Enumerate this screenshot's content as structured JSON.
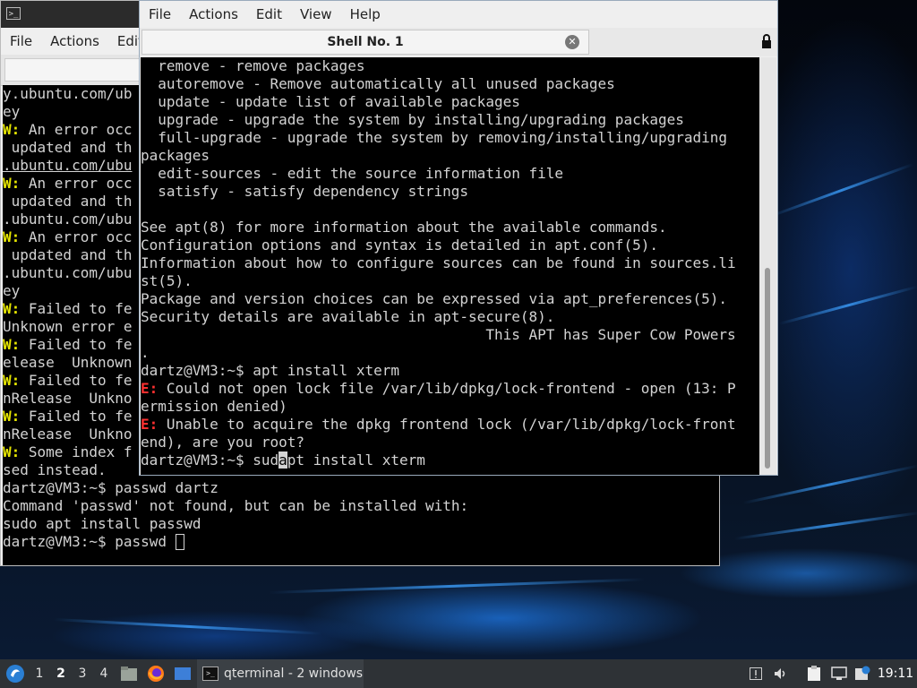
{
  "colors": {
    "terminal_bg": "#000000",
    "terminal_fg": "#d3d3d3",
    "warning": "#e6e600",
    "error": "#ff3030",
    "taskbar_bg": "#2e3236",
    "menubar_bg": "#efefef"
  },
  "back_window": {
    "menu": [
      "File",
      "Actions",
      "Edit"
    ],
    "terminal_lines": [
      {
        "prefix": "",
        "text": "y.ubuntu.com/ub",
        "style": ""
      },
      {
        "prefix": "",
        "text": "ey",
        "style": ""
      },
      {
        "prefix": "W:",
        "text": " An error occ",
        "style": ""
      },
      {
        "prefix": "",
        "text": " updated and th",
        "style": ""
      },
      {
        "prefix": "",
        "text": ".ubuntu.com/ubu",
        "style": "ul"
      },
      {
        "prefix": "W:",
        "text": " An error occ",
        "style": ""
      },
      {
        "prefix": "",
        "text": " updated and th",
        "style": ""
      },
      {
        "prefix": "",
        "text": ".ubuntu.com/ubu",
        "style": ""
      },
      {
        "prefix": "W:",
        "text": " An error occ",
        "style": ""
      },
      {
        "prefix": "",
        "text": " updated and th",
        "style": ""
      },
      {
        "prefix": "",
        "text": ".ubuntu.com/ubu",
        "style": ""
      },
      {
        "prefix": "",
        "text": "ey",
        "style": ""
      },
      {
        "prefix": "W:",
        "text": " Failed to fe",
        "style": ""
      },
      {
        "prefix": "",
        "text": "Unknown error e",
        "style": ""
      },
      {
        "prefix": "W:",
        "text": " Failed to fe",
        "style": ""
      },
      {
        "prefix": "",
        "text": "elease  Unknown",
        "style": ""
      },
      {
        "prefix": "W:",
        "text": " Failed to fe",
        "style": ""
      },
      {
        "prefix": "",
        "text": "nRelease  Unkno",
        "style": ""
      },
      {
        "prefix": "W:",
        "text": " Failed to fe",
        "style": ""
      },
      {
        "prefix": "",
        "text": "nRelease  Unkno",
        "style": ""
      },
      {
        "prefix": "W:",
        "text": " Some index f",
        "style": ""
      },
      {
        "prefix": "",
        "text": "sed instead.",
        "style": ""
      },
      {
        "prefix": "",
        "text": "dartz@VM3:~$ passwd dartz",
        "style": ""
      },
      {
        "prefix": "",
        "text": "Command 'passwd' not found, but can be installed with:",
        "style": ""
      },
      {
        "prefix": "",
        "text": "sudo apt install passwd",
        "style": ""
      },
      {
        "prefix": "",
        "text": "dartz@VM3:~$ passwd ",
        "style": "cursor"
      }
    ]
  },
  "front_window": {
    "menu": [
      "File",
      "Actions",
      "Edit",
      "View",
      "Help"
    ],
    "tab_title": "Shell No. 1",
    "terminal_lines": [
      {
        "prefix": "",
        "text": "  remove - remove packages"
      },
      {
        "prefix": "",
        "text": "  autoremove - Remove automatically all unused packages"
      },
      {
        "prefix": "",
        "text": "  update - update list of available packages"
      },
      {
        "prefix": "",
        "text": "  upgrade - upgrade the system by installing/upgrading packages"
      },
      {
        "prefix": "",
        "text": "  full-upgrade - upgrade the system by removing/installing/upgrading"
      },
      {
        "prefix": "",
        "text": "packages"
      },
      {
        "prefix": "",
        "text": "  edit-sources - edit the source information file"
      },
      {
        "prefix": "",
        "text": "  satisfy - satisfy dependency strings"
      },
      {
        "prefix": "",
        "text": ""
      },
      {
        "prefix": "",
        "text": "See apt(8) for more information about the available commands."
      },
      {
        "prefix": "",
        "text": "Configuration options and syntax is detailed in apt.conf(5)."
      },
      {
        "prefix": "",
        "text": "Information about how to configure sources can be found in sources.li"
      },
      {
        "prefix": "",
        "text": "st(5)."
      },
      {
        "prefix": "",
        "text": "Package and version choices can be expressed via apt_preferences(5)."
      },
      {
        "prefix": "",
        "text": "Security details are available in apt-secure(8)."
      },
      {
        "prefix": "",
        "text": "                                        This APT has Super Cow Powers"
      },
      {
        "prefix": "",
        "text": "."
      },
      {
        "prefix": "",
        "text": "dartz@VM3:~$ apt install xterm"
      },
      {
        "prefix": "E:",
        "text": " Could not open lock file /var/lib/dpkg/lock-frontend - open (13: P"
      },
      {
        "prefix": "",
        "text": "ermission denied)"
      },
      {
        "prefix": "E:",
        "text": " Unable to acquire the dpkg frontend lock (/var/lib/dpkg/lock-front"
      },
      {
        "prefix": "",
        "text": "end), are you root?"
      }
    ],
    "prompt_line": {
      "before": "dartz@VM3:~$ sud",
      "cursor": "a",
      "after": "pt install xterm"
    }
  },
  "taskbar": {
    "workspaces": [
      "1",
      "2",
      "3",
      "4"
    ],
    "active_workspace": "2",
    "task_label": "qterminal - 2 windows",
    "clock": "19:11"
  }
}
